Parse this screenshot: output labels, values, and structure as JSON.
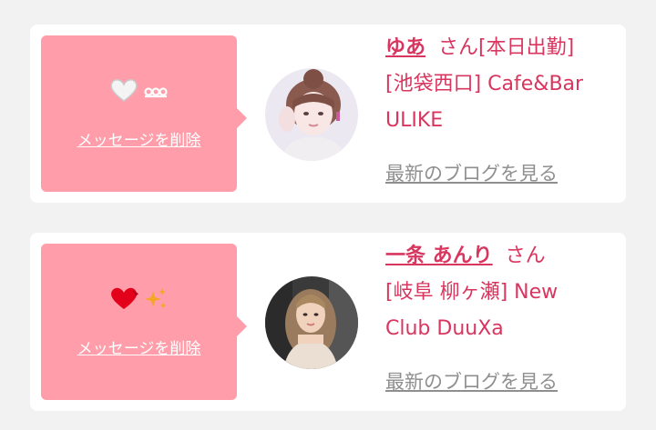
{
  "cards": [
    {
      "bubble": {
        "delete_label": "メッセージを削除"
      },
      "name": "ゆあ",
      "honorific": "さん",
      "line1_tail": "[本日出勤]",
      "line2": "[池袋西口] Cafe&Bar",
      "line3": "ULIKE",
      "blog_link": "最新のブログを見る"
    },
    {
      "bubble": {
        "delete_label": "メッセージを削除"
      },
      "name": "一条 あんり",
      "honorific": "さん",
      "line1_tail": "",
      "line2": "[岐阜 柳ヶ瀬] New",
      "line3": "Club DuuXa",
      "blog_link": "最新のブログを見る"
    }
  ],
  "colors": {
    "background": "#f2f2f2",
    "card": "#ffffff",
    "bubble": "#ff9eaa",
    "accent": "#d9365f",
    "link_gray": "#8f8f8f"
  },
  "icons": [
    "white-heart-icon",
    "loops-icon",
    "red-heart-icon",
    "sparkles-icon"
  ]
}
